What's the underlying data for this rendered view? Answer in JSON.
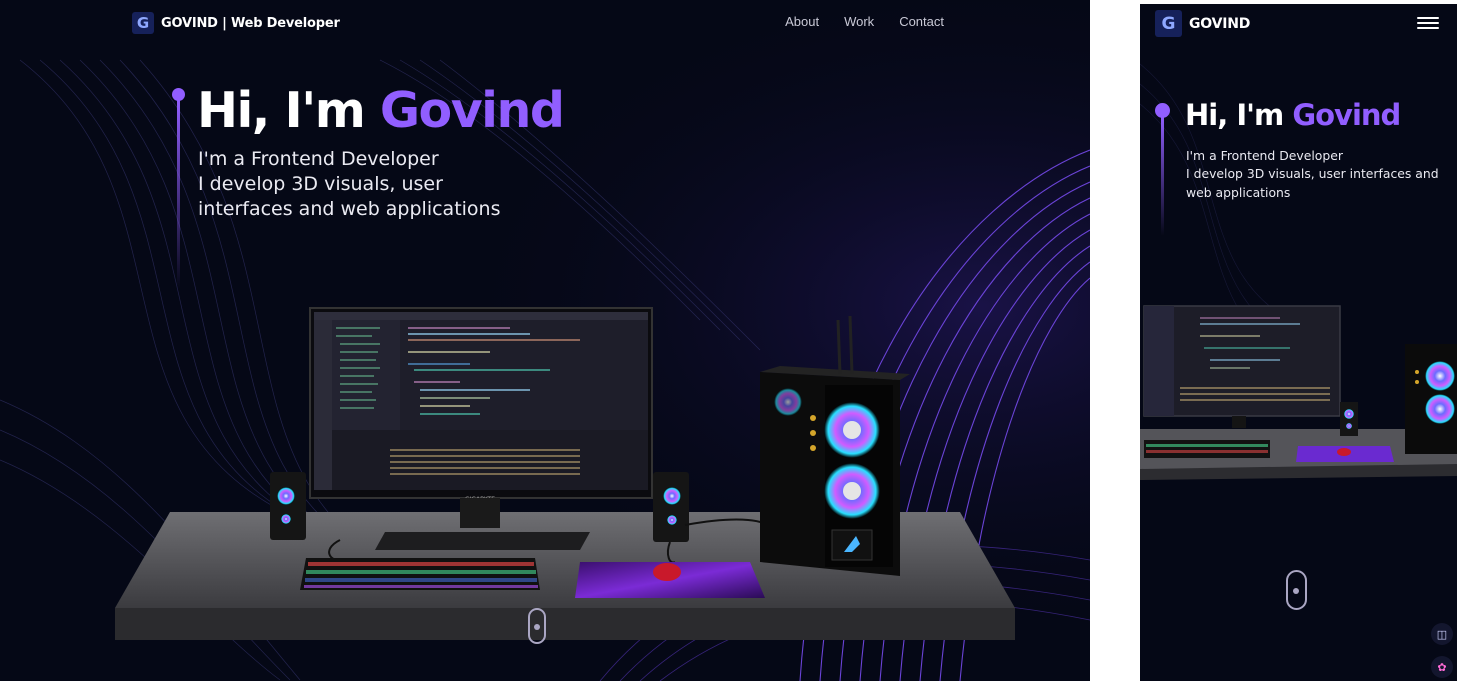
{
  "desktop": {
    "nav": {
      "logo_letter": "G",
      "brand": "GOVIND | Web Developer",
      "links": [
        "About",
        "Work",
        "Contact"
      ]
    },
    "hero": {
      "greeting": "Hi, I'm ",
      "name": "Govind",
      "lines": [
        "I'm a Frontend Developer",
        "I develop 3D visuals, user",
        "interfaces and web applications"
      ]
    },
    "monitor_brand": "GIGABYTE"
  },
  "mobile": {
    "nav": {
      "logo_letter": "G",
      "brand": "GOVIND"
    },
    "hero": {
      "greeting": "Hi, I'm ",
      "name": "Govind",
      "lines": [
        "I'm a Frontend Developer",
        "I develop 3D visuals, user interfaces and",
        "web applications"
      ]
    },
    "side_buttons": [
      "book-icon",
      "brain-icon"
    ]
  },
  "colors": {
    "background": "#050816",
    "accent": "#915eff",
    "text": "#ffffff"
  }
}
